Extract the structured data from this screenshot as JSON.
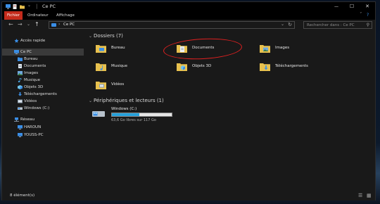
{
  "window": {
    "title": "Ce PC",
    "controls": {
      "minimize": "—",
      "maximize": "☐",
      "close": "✕"
    }
  },
  "ribbon": {
    "tabs": [
      "Fichier",
      "Ordinateur",
      "Affichage"
    ],
    "expand_glyph": "ˇ",
    "help_glyph": "?"
  },
  "address": {
    "crumb": "Ce PC",
    "search_placeholder": "Rechercher dans : Ce PC"
  },
  "sidebar": {
    "quick_access": "Accès rapide",
    "this_pc": "Ce PC",
    "items": [
      "Bureau",
      "Documents",
      "Images",
      "Musique",
      "Objets 3D",
      "Téléchargements",
      "Vidéos",
      "Windows (C:)"
    ],
    "network": "Réseau",
    "network_items": [
      "HAROUN",
      "YOUSS-PC"
    ]
  },
  "folders_group": {
    "title": "Dossiers (7)",
    "folders": [
      "Bureau",
      "Documents",
      "Images",
      "Musique",
      "Objets 3D",
      "Téléchargements",
      "Vidéos"
    ]
  },
  "devices_group": {
    "title": "Périphériques et lecteurs (1)",
    "drive": {
      "name": "Windows (C:)",
      "free_text": "63,6 Go libres sur 117 Go",
      "used_fraction": 0.46
    }
  },
  "status": {
    "count": "8 élément(s)"
  },
  "colors": {
    "accent_red": "#c42b1c",
    "folder_yellow": "#e8c14e",
    "drive_bar": "#26a0da",
    "annotation": "#e02020"
  }
}
